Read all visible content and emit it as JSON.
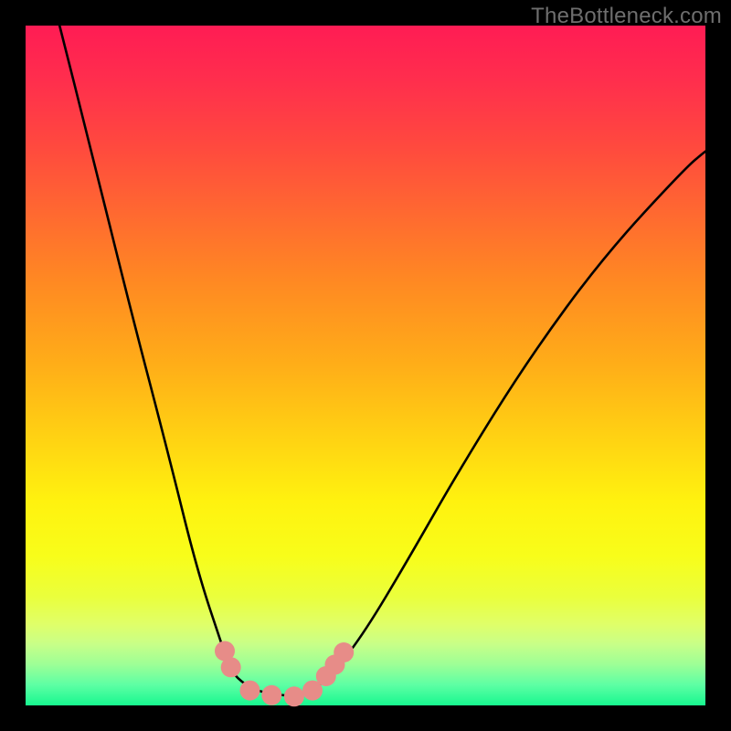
{
  "watermark": "TheBottleneck.com",
  "chart_data": {
    "type": "line",
    "title": "",
    "xlabel": "",
    "ylabel": "",
    "xlim": [
      0.0,
      1.0
    ],
    "ylim": [
      0.0,
      1.0
    ],
    "series": [
      {
        "name": "bottleneck-curve",
        "x": [
          0.05,
          0.093,
          0.155,
          0.21,
          0.252,
          0.29,
          0.302,
          0.323,
          0.35,
          0.4,
          0.42,
          0.455,
          0.5,
          0.56,
          0.64,
          0.74,
          0.85,
          0.97,
          1.0
        ],
        "y": [
          1.0,
          0.83,
          0.58,
          0.37,
          0.2,
          0.085,
          0.05,
          0.03,
          0.018,
          0.013,
          0.02,
          0.05,
          0.11,
          0.21,
          0.35,
          0.51,
          0.66,
          0.79,
          0.815
        ]
      }
    ],
    "markers": {
      "name": "highlight-points",
      "color": "#e78c88",
      "points": [
        {
          "x": 0.293,
          "y": 0.08
        },
        {
          "x": 0.302,
          "y": 0.056
        },
        {
          "x": 0.33,
          "y": 0.022
        },
        {
          "x": 0.362,
          "y": 0.015
        },
        {
          "x": 0.395,
          "y": 0.013
        },
        {
          "x": 0.422,
          "y": 0.022
        },
        {
          "x": 0.442,
          "y": 0.043
        },
        {
          "x": 0.455,
          "y": 0.06
        },
        {
          "x": 0.468,
          "y": 0.078
        }
      ]
    },
    "background_gradient": {
      "top_color": "#ff1c54",
      "bottom_color": "#17f78f"
    }
  }
}
